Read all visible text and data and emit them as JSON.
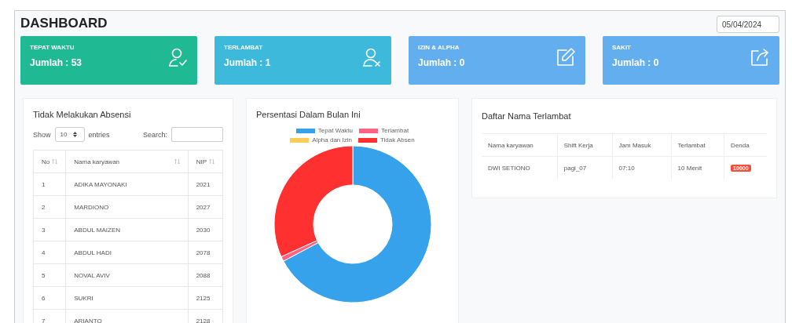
{
  "title": "DASHBOARD",
  "date": "05/04/2024",
  "cards": [
    {
      "label": "TEPAT WAKTU",
      "value": "Jumlah : 53",
      "color": "#1fb993",
      "kind": "user-check"
    },
    {
      "label": "TERLAMBAT",
      "value": "Jumlah : 1",
      "color": "#3db9dc",
      "kind": "user-x"
    },
    {
      "label": "IZIN & ALPHA",
      "value": "Jumlah : 0",
      "color": "#63aeef",
      "kind": "edit"
    },
    {
      "label": "SAKIT",
      "value": "Jumlah : 0",
      "color": "#63aeef",
      "kind": "share"
    }
  ],
  "absent": {
    "title": "Tidak Melakukan Absensi",
    "show": "Show",
    "page_size": "10",
    "entries": "entries",
    "search_label": "Search:",
    "columns": [
      "No",
      "Nama karyawan",
      "NIP"
    ],
    "rows": [
      [
        "1",
        "ADIKA MAYONAKI",
        "2021"
      ],
      [
        "2",
        "MARDIONO",
        "2027"
      ],
      [
        "3",
        "ABDUL MAIZEN",
        "2030"
      ],
      [
        "4",
        "ABDUL HADI",
        "2078"
      ],
      [
        "5",
        "NOVAL AVIV",
        "2088"
      ],
      [
        "6",
        "SUKRI",
        "2125"
      ],
      [
        "7",
        "ARIANTO",
        "2128"
      ]
    ]
  },
  "chart": {
    "title": "Persentasi Dalam Bulan Ini",
    "legend": [
      {
        "label": "Tepat Waktu",
        "color": "#36a2eb"
      },
      {
        "label": "Terlambat",
        "color": "#ff6384"
      },
      {
        "label": "Alpha dan Izin",
        "color": "#ffcd56"
      },
      {
        "label": "Tidak Absen",
        "color": "#ff3030"
      }
    ]
  },
  "late": {
    "title": "Daftar Nama Terlambat",
    "columns": [
      "Nama karyawan",
      "Shift Kerja",
      "Jam Masuk",
      "Terlambat",
      "Denda"
    ],
    "rows": [
      {
        "cells": [
          "DWI SETIONO",
          "pagi_07",
          "07:10",
          "10 Menit"
        ],
        "fine": "10000"
      }
    ]
  }
}
